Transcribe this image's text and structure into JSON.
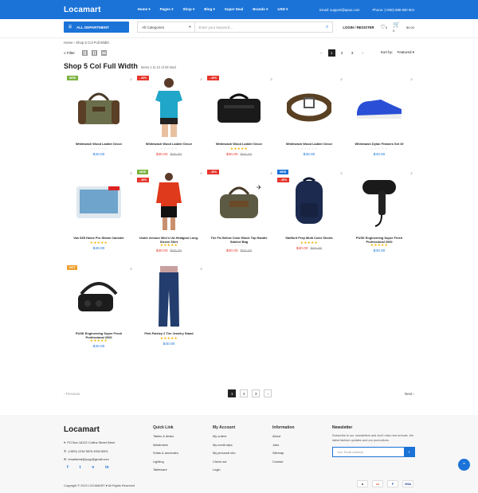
{
  "header": {
    "logo": "Locamart",
    "nav": [
      {
        "label": "Home",
        "caret": "▾"
      },
      {
        "label": "Pages",
        "caret": "▾"
      },
      {
        "label": "Shop",
        "caret": "▾"
      },
      {
        "label": "Blog",
        "caret": "▾"
      },
      {
        "label": "Super Deal",
        "caret": ""
      },
      {
        "label": "Brands",
        "caret": "▾"
      },
      {
        "label": "USD",
        "caret": "▾"
      }
    ],
    "email": "Email: support@apus.com",
    "phone": "Phone: (+800) 888 800 904",
    "all_department": "ALL DEPARTMENT",
    "category_select": "All Categories",
    "search_placeholder": "Enter your keyword...",
    "login": "LOGIN / REGISTER",
    "wishlist_count": "0",
    "cart_count": "0",
    "cart_total": "$0.00"
  },
  "breadcrumb": "Home  ›  Shop 5 Col Full Width",
  "toolbar": {
    "filter": "Filter",
    "pages": [
      "1",
      "2",
      "3"
    ],
    "sort_label": "Sort by:",
    "sort_value": "Featured"
  },
  "page_title": "Shop 5 Col Full Width",
  "results_text": "Items 1 to 12 of 28 total",
  "products": [
    {
      "name": "Whitewash Wood Ladder Decor",
      "price": "$40.00",
      "old_price": "",
      "badge": "NEW",
      "badge_color": "#7cb342",
      "badge2": "",
      "rating": "☆☆☆☆☆"
    },
    {
      "name": "Whitewash Wood Ladder Decor",
      "price": "$40.00",
      "old_price": "$80.00",
      "badge": "- 40%",
      "badge_color": "#e5352b",
      "badge2": "",
      "rating": "☆☆☆☆☆"
    },
    {
      "name": "Whitewash Wood Ladder Decor",
      "price": "$40.00",
      "old_price": "$80.00",
      "badge": "- 40%",
      "badge_color": "#e5352b",
      "badge2": "",
      "rating": "★★★★★"
    },
    {
      "name": "Whitewash Wood Ladder Decor",
      "price": "$40.00",
      "old_price": "",
      "badge": "",
      "badge_color": "",
      "badge2": "",
      "rating": "☆☆☆☆☆"
    },
    {
      "name": "Whitewash Dylan Framers Set Of",
      "price": "$40.00",
      "old_price": "",
      "badge": "",
      "badge_color": "",
      "badge2": "",
      "rating": "☆☆☆☆☆"
    },
    {
      "name": "Vax S65 Home Pro Steam Canister",
      "price": "$40.00",
      "old_price": "",
      "badge": "",
      "badge_color": "",
      "badge2": "",
      "rating": "★★★★★"
    },
    {
      "name": "Under Armour Men's UA Heatgear Long-Sleeve Shirt",
      "price": "$40.00",
      "old_price": "$80.00",
      "badge": "NEW",
      "badge_color": "#7cb342",
      "badge2": "- 40%",
      "rating": "★★★★★"
    },
    {
      "name": "The Fix Below Color Block Top Handle Satchel Bag",
      "price": "$40.00",
      "old_price": "$80.00",
      "badge": "- 40%",
      "badge_color": "#e5352b",
      "badge2": "",
      "rating": "☆☆☆☆☆"
    },
    {
      "name": "Stafford Prep Multi Color Shorts",
      "price": "$40.00",
      "old_price": "$80.00",
      "badge": "NEW",
      "badge_color": "#1b73d8",
      "badge2": "- 40%",
      "rating": "★★★★★"
    },
    {
      "name": "PUSK Engineering Super Fresh Professional 2000",
      "price": "$40.00",
      "old_price": "",
      "badge": "",
      "badge_color": "",
      "badge2": "",
      "rating": "★★★★★"
    },
    {
      "name": "PUSK Engineering Super Fresh Professional 2000",
      "price": "$40.00",
      "old_price": "",
      "badge": "HOT",
      "badge_color": "#f0a030",
      "badge2": "",
      "rating": "★★★★★"
    },
    {
      "name": "Pink Paisley 2 Tier Jewelry Stand",
      "price": "$40.00",
      "old_price": "",
      "badge": "",
      "badge_color": "",
      "badge2": "",
      "rating": "★★★★★"
    }
  ],
  "bottom_pager": {
    "prev": "‹  Previous",
    "pages": [
      "1",
      "2",
      "3",
      "›"
    ],
    "next": "Next  ›"
  },
  "footer": {
    "logo": "Locamart",
    "address": "PO Box 16122 Collins Street West",
    "phone": "(+800) 1234 5678 4934 8901",
    "email": "emailsend@yoyy@gmail.com",
    "social": [
      "f",
      "t",
      "v",
      "in"
    ],
    "columns": [
      {
        "title": "Quick Link",
        "items": [
          "Tables & desks",
          "Wardrobes",
          "Sofas & armchairs",
          "Lighting",
          "Tableware"
        ]
      },
      {
        "title": "My Account",
        "items": [
          "My orders",
          "My credit slips",
          "My personal info",
          "Check out",
          "Login"
        ]
      },
      {
        "title": "Information",
        "items": [
          "About",
          "Jobs",
          "Sitemap",
          "Contact"
        ]
      }
    ],
    "newsletter_title": "Newsletter",
    "newsletter_text": "Subscribe to our newsletters and don't miss new arrivals, the latest fashion updates and our promotions.",
    "newsletter_placeholder": "Your Email Address",
    "copyright": "Copyright © 2019 LOCAMART ♥ All Rights Reserved",
    "payments": [
      "a",
      "●●",
      "P",
      "VISA"
    ]
  },
  "colors": {
    "accent": "#1b73d8",
    "sale": "#e5352b",
    "star": "#f5b400"
  }
}
